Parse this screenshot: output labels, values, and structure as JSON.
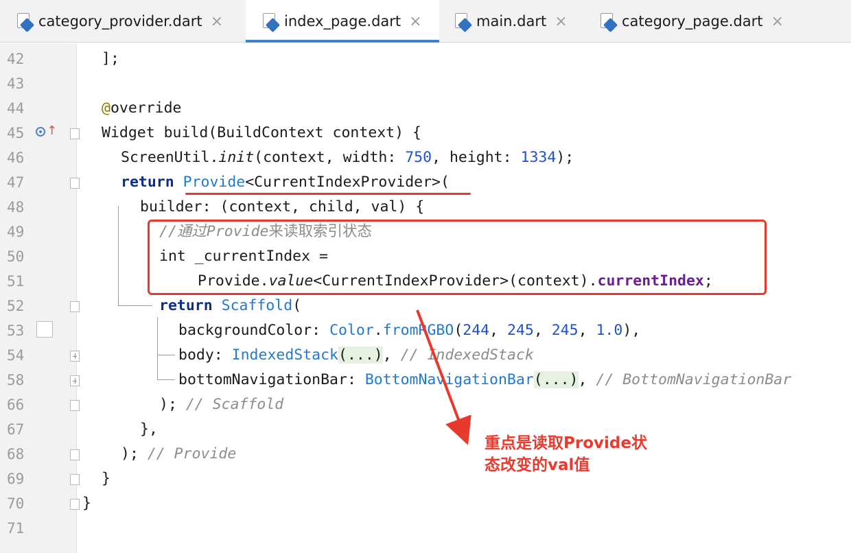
{
  "tabs": [
    {
      "label": "category_provider.dart",
      "close": "×",
      "active": false
    },
    {
      "label": "index_page.dart",
      "close": "×",
      "active": true
    },
    {
      "label": "main.dart",
      "close": "×",
      "active": false
    },
    {
      "label": "category_page.dart",
      "close": "×",
      "active": false
    }
  ],
  "line_numbers": [
    "42",
    "43",
    "44",
    "45",
    "46",
    "47",
    "48",
    "49",
    "50",
    "51",
    "52",
    "53",
    "54",
    "58",
    "66",
    "67",
    "68",
    "69",
    "70",
    "71"
  ],
  "code": {
    "l42": {
      "text": "];"
    },
    "l44": {
      "at": "@",
      "text": "override"
    },
    "l45": {
      "text": "Widget build(BuildContext context) {"
    },
    "l46": {
      "a": "ScreenUtil.",
      "b": "init",
      "c": "(context, width: ",
      "n1": "750",
      "d": ", height: ",
      "n2": "1334",
      "e": ");"
    },
    "l47": {
      "kw": "return",
      "cls": "Provide",
      "rest": "<CurrentIndexProvider>("
    },
    "l48": {
      "text": "builder: (context, child, val) {"
    },
    "l49": {
      "c1": "//通过",
      "c2": "Provide",
      "c3": "来读取索引状态"
    },
    "l50": {
      "text": "int _currentIndex ="
    },
    "l51": {
      "a": "Provide.",
      "b": "value",
      "c": "<CurrentIndexProvider>(context).",
      "prop": "currentIndex",
      "end": ";"
    },
    "l52": {
      "kw": "return",
      "cls": "Scaffold",
      "rest": "("
    },
    "l53": {
      "a": "backgroundColor: ",
      "cls": "Color",
      "dot": ".",
      "fn": "fromRGBO",
      "p": "(",
      "n1": "244",
      "s1": ", ",
      "n2": "245",
      "s2": ", ",
      "n3": "245",
      "s3": ", ",
      "n4": "1.0",
      "end": "),"
    },
    "l54": {
      "a": "body: ",
      "cls": "IndexedStack",
      "fold": "(...)",
      "b": ", ",
      "cm": "// IndexedStack"
    },
    "l58": {
      "a": "bottomNavigationBar: ",
      "cls": "BottomNavigationBar",
      "fold": "(...)",
      "b": ", ",
      "cm": "// BottomNavigationBar"
    },
    "l66": {
      "a": "); ",
      "cm": "// Scaffold"
    },
    "l67": {
      "text": "},"
    },
    "l68": {
      "a": "); ",
      "cm": "// Provide"
    },
    "l69": {
      "text": "}"
    },
    "l70": {
      "text": "}"
    }
  },
  "annotation": {
    "line1": "重点是读取Provide状",
    "line2": "态改变的val值"
  },
  "colors": {
    "annotation_red": "#e8392d",
    "keyword": "#0b2f8a",
    "class": "#1f7ad6",
    "number": "#1c52d9",
    "comment": "#8c8c8c",
    "property": "#6b1f8f",
    "tab_accent": "#4083c9"
  },
  "icons": [
    "dart-file-icon",
    "close-icon",
    "override-method-icon",
    "fold-icon",
    "unfold-icon"
  ]
}
